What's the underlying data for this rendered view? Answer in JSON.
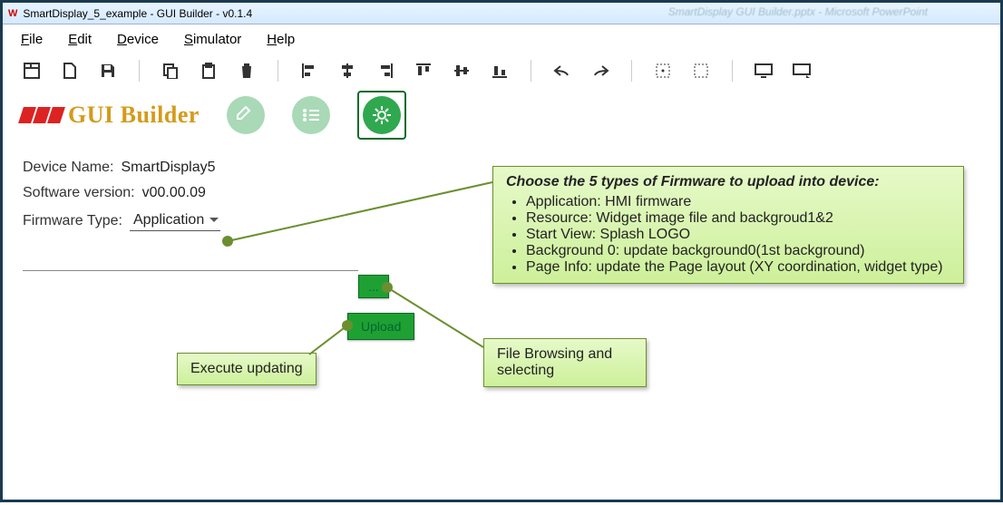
{
  "window": {
    "title": "SmartDisplay_5_example - GUI Builder - v0.1.4",
    "background_hint": "SmartDisplay GUI Builder.pptx - Microsoft PowerPoint"
  },
  "menu": {
    "file": "File",
    "edit": "Edit",
    "device": "Device",
    "simulator": "Simulator",
    "help": "Help"
  },
  "brand": {
    "name": "GUI Builder"
  },
  "form": {
    "device_label": "Device Name:",
    "device_value": "SmartDisplay5",
    "version_label": "Software version:",
    "version_value": "v00.00.09",
    "fwtype_label": "Firmware Type:",
    "fwtype_value": "Application",
    "browse_btn": "...",
    "upload_btn": "Upload"
  },
  "callouts": {
    "main": {
      "title": "Choose the 5 types of  Firmware to upload into device:",
      "items": [
        "Application: HMI firmware",
        "Resource: Widget image file and backgroud1&2",
        "Start View: Splash LOGO",
        "Background 0: update background0(1st background)",
        "Page Info: update the Page layout (XY coordination, widget type)"
      ]
    },
    "browse": "File Browsing and selecting",
    "upload": "Execute updating"
  }
}
